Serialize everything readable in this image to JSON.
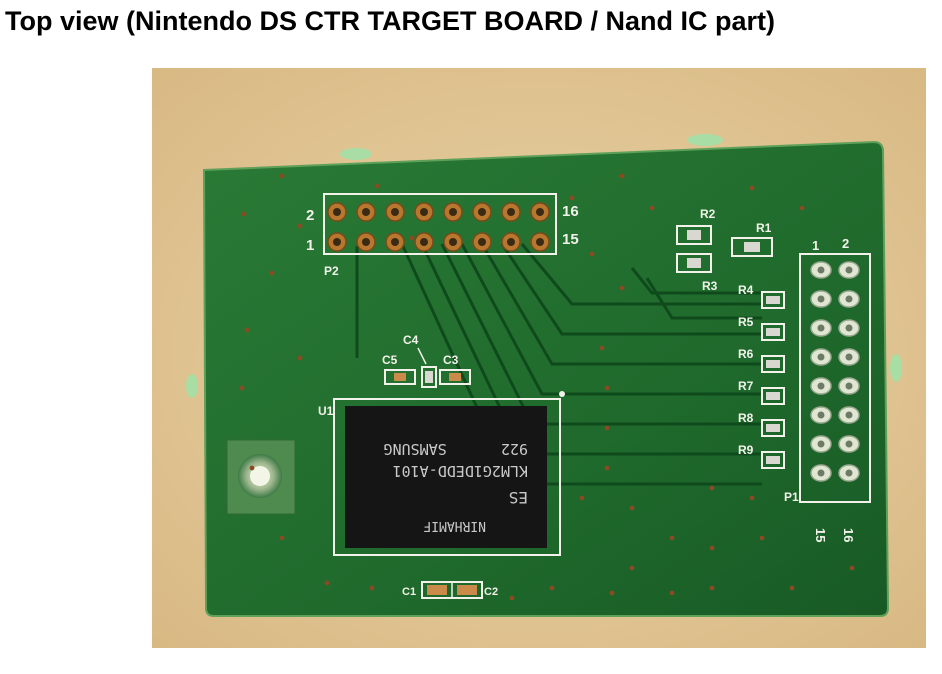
{
  "document": {
    "title": "Top view (Nintendo DS CTR TARGET BOARD / Nand IC part)"
  },
  "colors": {
    "background_wood": "#e3c89a",
    "pcb_green": "#1f6a2c",
    "silkscreen": "#f2f2ea",
    "chip_black": "#151515"
  },
  "board": {
    "connector_p2": {
      "ref": "P2",
      "pin_labels": {
        "top_left": "2",
        "bottom_left": "1",
        "top_right": "16",
        "bottom_right": "15"
      }
    },
    "connector_p1": {
      "ref": "P1",
      "pin_labels": {
        "top_left": "1",
        "top_right": "2",
        "bottom_left": "15",
        "bottom_right": "16"
      }
    },
    "resistors": [
      "R1",
      "R2",
      "R3",
      "R4",
      "R5",
      "R6",
      "R7",
      "R8",
      "R9"
    ],
    "capacitors": [
      "C1",
      "C2",
      "C3",
      "C4",
      "C5"
    ],
    "chip": {
      "ref": "U1",
      "markings": [
        "NIRHAMIF",
        "ES",
        "KLM2G1DEDD-A101",
        "922      SAMSUNG"
      ]
    }
  }
}
